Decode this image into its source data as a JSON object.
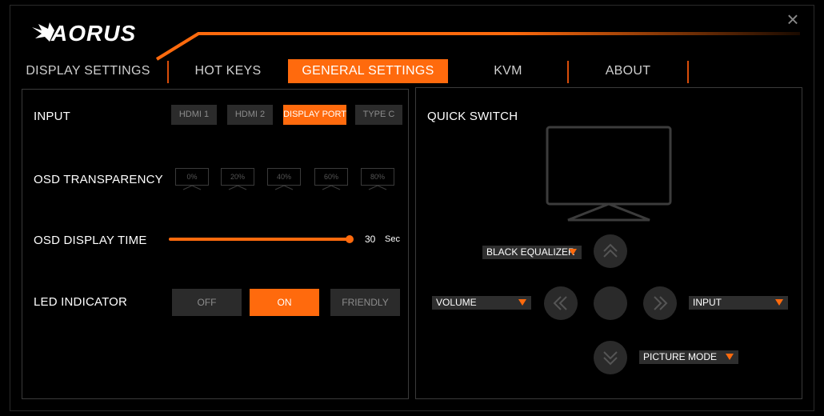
{
  "app": {
    "brand": "AORUS",
    "close_glyph": "×",
    "accent_color": "#ff6a0d"
  },
  "tabs": [
    {
      "label": "DISPLAY SETTINGS",
      "active": false
    },
    {
      "label": "HOT KEYS",
      "active": false
    },
    {
      "label": "GENERAL SETTINGS",
      "active": true
    },
    {
      "label": "KVM",
      "active": false
    },
    {
      "label": "ABOUT",
      "active": false
    }
  ],
  "general": {
    "input": {
      "label": "INPUT",
      "options": [
        "HDMI 1",
        "HDMI 2",
        "DISPLAY PORT",
        "TYPE C"
      ],
      "selected": "DISPLAY PORT"
    },
    "osd_transparency": {
      "label": "OSD TRANSPARENCY",
      "options": [
        "0%",
        "20%",
        "40%",
        "60%",
        "80%"
      ]
    },
    "osd_display_time": {
      "label": "OSD DISPLAY TIME",
      "value": "30",
      "unit": "Sec"
    },
    "led_indicator": {
      "label": "LED INDICATOR",
      "options": [
        "OFF",
        "ON",
        "FRIENDLY"
      ],
      "selected": "ON"
    }
  },
  "quick_switch": {
    "title": "QUICK SWITCH",
    "up": "BLACK EQUALIZER",
    "left": "VOLUME",
    "right": "INPUT",
    "down": "PICTURE MODE"
  }
}
